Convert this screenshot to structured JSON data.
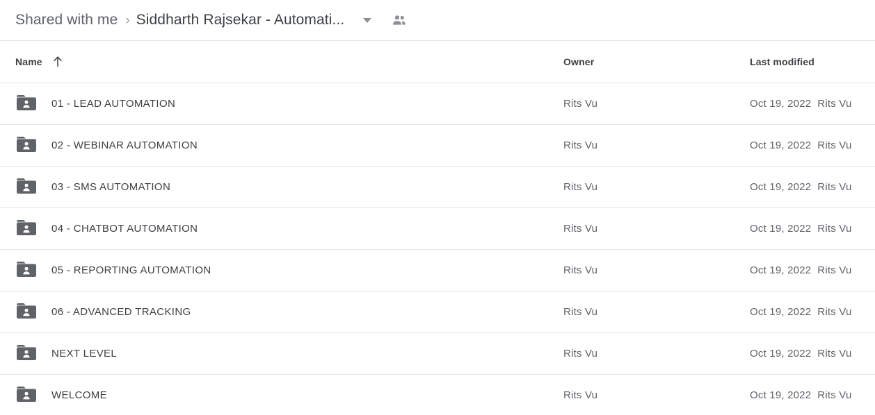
{
  "breadcrumb": {
    "parent": "Shared with me",
    "separator": "›",
    "current": "Siddharth Rajsekar - Automati...",
    "caret_icon": "chevron-down-icon",
    "people_icon": "people-icon"
  },
  "columns": {
    "name": "Name",
    "sort_icon": "arrow-up-icon",
    "owner": "Owner",
    "last_modified": "Last modified"
  },
  "colors": {
    "text_primary": "#3c4043",
    "text_secondary": "#5f6368",
    "divider": "#e3e3e3",
    "folder_icon": "#5f6368",
    "background": "#ffffff"
  },
  "rows": [
    {
      "name": "01 - LEAD AUTOMATION",
      "icon": "shared-folder-icon",
      "owner": "Rits Vu",
      "modified_date": "Oct 19, 2022",
      "modified_by": "Rits Vu"
    },
    {
      "name": "02 - WEBINAR AUTOMATION",
      "icon": "shared-folder-icon",
      "owner": "Rits Vu",
      "modified_date": "Oct 19, 2022",
      "modified_by": "Rits Vu"
    },
    {
      "name": "03 - SMS AUTOMATION",
      "icon": "shared-folder-icon",
      "owner": "Rits Vu",
      "modified_date": "Oct 19, 2022",
      "modified_by": "Rits Vu"
    },
    {
      "name": "04 - CHATBOT AUTOMATION",
      "icon": "shared-folder-icon",
      "owner": "Rits Vu",
      "modified_date": "Oct 19, 2022",
      "modified_by": "Rits Vu"
    },
    {
      "name": "05 - REPORTING AUTOMATION",
      "icon": "shared-folder-icon",
      "owner": "Rits Vu",
      "modified_date": "Oct 19, 2022",
      "modified_by": "Rits Vu"
    },
    {
      "name": "06 - ADVANCED TRACKING",
      "icon": "shared-folder-icon",
      "owner": "Rits Vu",
      "modified_date": "Oct 19, 2022",
      "modified_by": "Rits Vu"
    },
    {
      "name": "NEXT LEVEL",
      "icon": "shared-folder-icon",
      "owner": "Rits Vu",
      "modified_date": "Oct 19, 2022",
      "modified_by": "Rits Vu"
    },
    {
      "name": "WELCOME",
      "icon": "shared-folder-icon",
      "owner": "Rits Vu",
      "modified_date": "Oct 19, 2022",
      "modified_by": "Rits Vu"
    }
  ]
}
